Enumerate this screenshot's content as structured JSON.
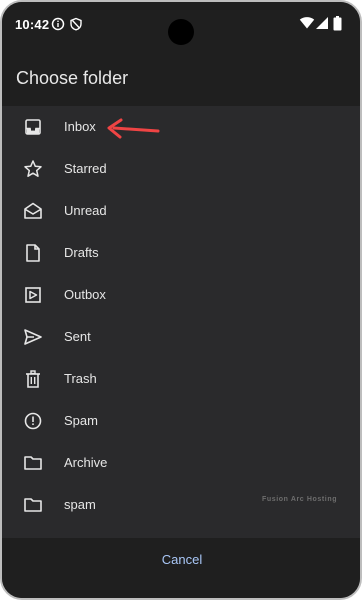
{
  "status_bar": {
    "time": "10:42",
    "icons": [
      "info-circle-icon",
      "shield-icon"
    ],
    "system_icons": [
      "wifi-icon",
      "signal-icon",
      "battery-icon"
    ]
  },
  "dialog": {
    "title": "Choose folder",
    "folders": [
      {
        "label": "Inbox",
        "icon": "inbox-icon"
      },
      {
        "label": "Starred",
        "icon": "star-icon"
      },
      {
        "label": "Unread",
        "icon": "unread-mail-icon"
      },
      {
        "label": "Drafts",
        "icon": "draft-icon"
      },
      {
        "label": "Outbox",
        "icon": "outbox-icon"
      },
      {
        "label": "Sent",
        "icon": "send-icon"
      },
      {
        "label": "Trash",
        "icon": "trash-icon"
      },
      {
        "label": "Spam",
        "icon": "report-icon"
      },
      {
        "label": "Archive",
        "icon": "folder-icon"
      },
      {
        "label": "spam",
        "icon": "folder-icon"
      }
    ],
    "cancel_label": "Cancel"
  },
  "watermark": "Fusion Arc Hosting",
  "annotation": {
    "icon": "red-arrow-icon",
    "color": "#ef4444"
  },
  "colors": {
    "background": "#1f1f1f",
    "list_background": "#2a2a2c",
    "text": "#e6e6e6",
    "accent": "#a9c7f7"
  }
}
